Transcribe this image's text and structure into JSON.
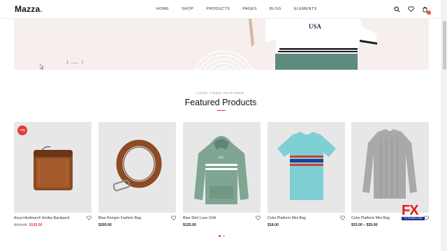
{
  "header": {
    "logo": "Mazza",
    "logo_dot": ".",
    "nav": [
      "HOME",
      "SHOP",
      "PRODUCTS",
      "PAGES",
      "BLOG",
      "ELEMENTS"
    ],
    "cart_count": "0",
    "icons": [
      "search-icon",
      "heart-icon",
      "cart-icon"
    ]
  },
  "hero": {
    "pagination": {
      "active": "1",
      "inactive": "2"
    },
    "shirt_print": "USA"
  },
  "section": {
    "kicker": "LOOK ITEMS FEATURED",
    "title": "Featured Products"
  },
  "products": [
    {
      "name": "Anya Hindmarch Smiley Backpack",
      "old_price": "$140.00",
      "price": "$130.00",
      "badge": "-7%"
    },
    {
      "name": "Blue Romper Fashion Bag",
      "price": "$205.00"
    },
    {
      "name": "Blue Shirt Love USA",
      "price": "$125.00"
    },
    {
      "name": "Color Platform Mini Bag",
      "price": "$18.00"
    },
    {
      "name": "Color Platform Mini Bag",
      "price": "$33.00 – $35.00"
    }
  ],
  "watermark": {
    "text": "FX",
    "sub": "FXTEAMS.COM"
  },
  "colors": {
    "accent": "#e53b3b",
    "hero_bg": "#f6efee",
    "card_bg": "#e7e7e7"
  }
}
